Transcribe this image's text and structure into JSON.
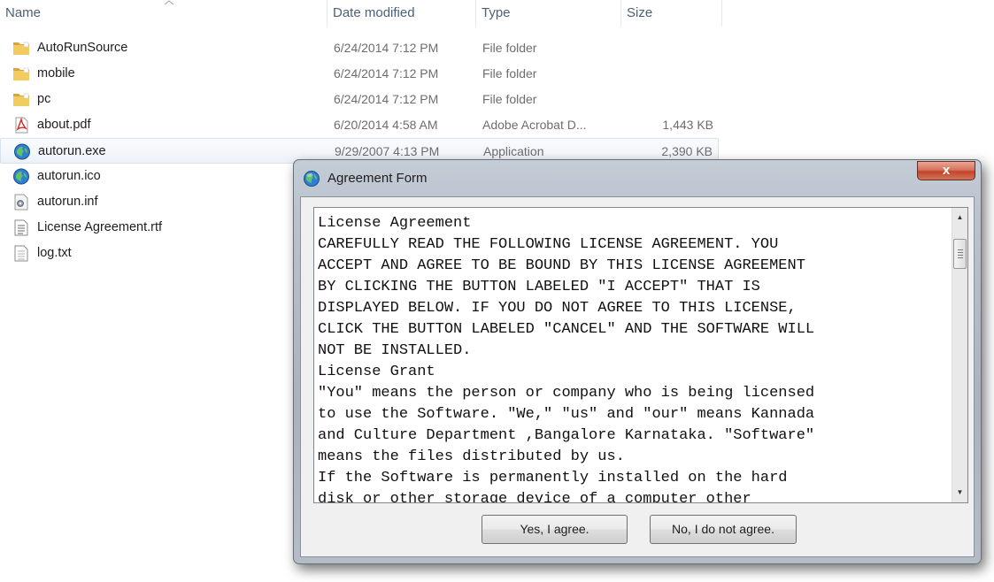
{
  "explorer": {
    "columns": {
      "name": "Name",
      "date": "Date modified",
      "type": "Type",
      "size": "Size"
    },
    "files": [
      {
        "name": "AutoRunSource",
        "date": "6/24/2014 7:12 PM",
        "type": "File folder",
        "size": "",
        "icon": "folder-icon"
      },
      {
        "name": "mobile",
        "date": "6/24/2014 7:12 PM",
        "type": "File folder",
        "size": "",
        "icon": "folder-icon"
      },
      {
        "name": "pc",
        "date": "6/24/2014 7:12 PM",
        "type": "File folder",
        "size": "",
        "icon": "folder-icon"
      },
      {
        "name": "about.pdf",
        "date": "6/20/2014 4:58 AM",
        "type": "Adobe Acrobat D...",
        "size": "1,443 KB",
        "icon": "pdf-icon"
      },
      {
        "name": "autorun.exe",
        "date": "9/29/2007 4:13 PM",
        "type": "Application",
        "size": "2,390 KB",
        "icon": "application-icon",
        "selected": true
      },
      {
        "name": "autorun.ico",
        "date": "",
        "type": "",
        "size": "",
        "icon": "application-icon"
      },
      {
        "name": "autorun.inf",
        "date": "",
        "type": "",
        "size": "",
        "icon": "settings-file-icon"
      },
      {
        "name": "License Agreement.rtf",
        "date": "",
        "type": "",
        "size": "",
        "icon": "rtf-document-icon"
      },
      {
        "name": "log.txt",
        "date": "",
        "type": "",
        "size": "",
        "icon": "text-file-icon"
      }
    ]
  },
  "dialog": {
    "title": "Agreement Form",
    "close_label": "x",
    "license_lines": [
      "License Agreement",
      "CAREFULLY READ THE FOLLOWING LICENSE AGREEMENT. YOU",
      "ACCEPT AND AGREE TO BE BOUND BY THIS LICENSE AGREEMENT",
      "BY CLICKING THE BUTTON LABELED \"I ACCEPT\" THAT IS",
      "DISPLAYED BELOW. IF YOU DO NOT AGREE TO THIS LICENSE,",
      "CLICK THE BUTTON LABELED \"CANCEL\" AND THE SOFTWARE WILL",
      "NOT BE INSTALLED.",
      "License Grant",
      "\"You\" means the person or company who is being licensed",
      "to use the Software. \"We,\" \"us\" and \"our\" means Kannada",
      "and Culture Department ,Bangalore Karnataka. \"Software\"",
      "means the files distributed by us.",
      "If the Software is permanently installed on the hard",
      "disk or other storage device of a computer other"
    ],
    "scroll_position": 0.05,
    "yes_label": "Yes, I agree.",
    "no_label": "No, I do not agree."
  },
  "colors": {
    "column_header_text": "#4c607a",
    "secondary_text": "#6d6d6d",
    "folder": "#e8b94a",
    "close_button": "#c2452b"
  }
}
